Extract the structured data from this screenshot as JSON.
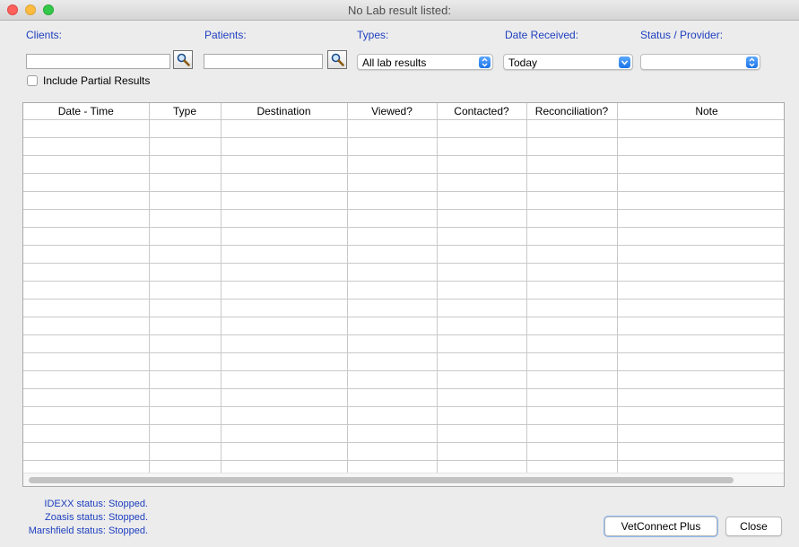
{
  "window": {
    "title": "No Lab result listed:"
  },
  "filters": {
    "clients_label": "Clients:",
    "clients_value": "",
    "patients_label": "Patients:",
    "patients_value": "",
    "types_label": "Types:",
    "types_value": "All lab results",
    "date_label": "Date Received:",
    "date_value": "Today",
    "status_label": "Status / Provider:",
    "status_value": "",
    "partial_label": "Include Partial Results",
    "partial_checked": false
  },
  "table": {
    "columns": [
      "Date - Time",
      "Type",
      "Destination",
      "Viewed?",
      "Contacted?",
      "Reconciliation?",
      "Note"
    ],
    "rows": []
  },
  "status_lines": {
    "idexx": "IDEXX status: Stopped.",
    "zoasis": "Zoasis status: Stopped.",
    "marshfield": "Marshfield status: Stopped."
  },
  "buttons": {
    "vetconnect": "VetConnect Plus",
    "close": "Close"
  },
  "icons": {
    "lookup": "magnifier-icon",
    "select_arrow": "up-down-chevron-icon"
  },
  "colors": {
    "label_blue": "#1e3fbf",
    "select_accent": "#1a73e8"
  }
}
